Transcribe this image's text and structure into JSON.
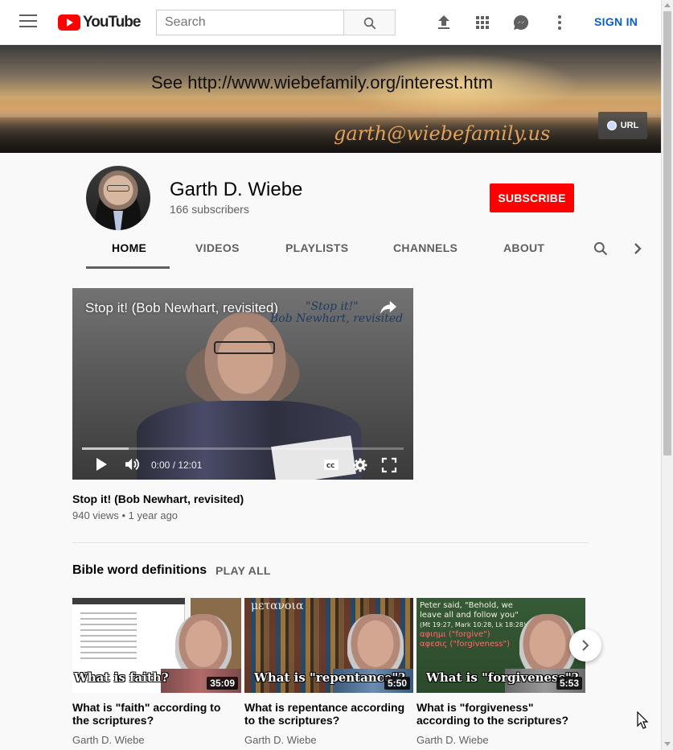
{
  "header": {
    "logo_text": "YouTube",
    "search_placeholder": "Search",
    "signin_label": "SIGN IN",
    "icons": [
      "menu-icon",
      "search-icon",
      "upload-icon",
      "apps-icon",
      "messages-icon",
      "more-vert-icon"
    ]
  },
  "banner": {
    "text": "See  http://www.wiebefamily.org/interest.htm",
    "email": "garth@wiebefamily.us",
    "url_button": "URL"
  },
  "channel": {
    "name": "Garth D. Wiebe",
    "subscribers": "166 subscribers",
    "subscribe_label": "SUBSCRIBE",
    "subscribe_color": "#ff0000"
  },
  "tabs": [
    {
      "label": "HOME",
      "active": true
    },
    {
      "label": "VIDEOS",
      "active": false
    },
    {
      "label": "PLAYLISTS",
      "active": false
    },
    {
      "label": "CHANNELS",
      "active": false
    },
    {
      "label": "ABOUT",
      "active": false
    }
  ],
  "featured": {
    "player_title": "Stop it! (Bob Newhart, revisited)",
    "overlay_line1": "\"Stop it!\"",
    "overlay_line2": "Bob Newhart, revisited",
    "time": "0:00 / 12:01",
    "title": "Stop it! (Bob Newhart, revisited)",
    "views": "940 views",
    "age": "1 year ago"
  },
  "shelf": {
    "title": "Bible word definitions",
    "play_all": "PLAY ALL",
    "videos": [
      {
        "thumb_caption": "What is faith?",
        "duration": "35:09",
        "title": "What is \"faith\" according to the scriptures?",
        "channel": "Garth D. Wiebe"
      },
      {
        "thumb_caption": "What is \"repentance\"?",
        "thumb_greek": "μετανοια",
        "duration": "5:50",
        "title": "What is repentance according to the scriptures?",
        "channel": "Garth D. Wiebe"
      },
      {
        "thumb_caption": "What is \"forgiveness\"?",
        "thumb_board_line1": "Peter said, \"Behold, we",
        "thumb_board_line2": "leave all and follow you\"",
        "thumb_board_line3": "(Mt 19:27, Mark 10:28, Lk 18:28)",
        "thumb_board_line4": "αφιημι (\"forgive\")",
        "thumb_board_line5": "αφεσις (\"forgiveness\")",
        "duration": "5:53",
        "title": "What is \"forgiveness\" according to the scriptures?",
        "channel": "Garth D. Wiebe"
      }
    ]
  },
  "accent_color": "#065fd4"
}
